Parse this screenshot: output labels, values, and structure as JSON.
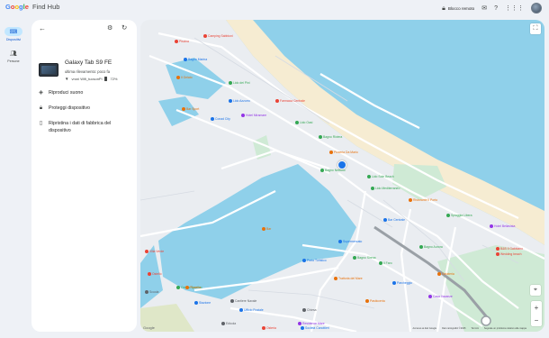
{
  "app": {
    "logo_text": "Google",
    "product": "Find Hub"
  },
  "topbar": {
    "lock_button": "Blocco remoto",
    "icons": [
      "lock-icon",
      "feedback-icon",
      "help-icon",
      "apps-grid-icon",
      "avatar"
    ]
  },
  "rail": {
    "items": [
      {
        "label": "Dispositivi",
        "icon": "devices-icon",
        "active": true
      },
      {
        "label": "Persone",
        "icon": "people-icon",
        "active": false
      }
    ]
  },
  "panel": {
    "device": {
      "name": "Galaxy Tab S9 FE",
      "last_seen": "ultima rilevamento: poco fa",
      "network": "vroni Wifi_tucsonPi",
      "battery": "72%"
    },
    "actions": [
      {
        "label": "Riproduci suono",
        "icon": "sound-icon"
      },
      {
        "label": "Proteggi dispositivo",
        "icon": "lock-icon"
      },
      {
        "label": "Ripristina i dati di fabbrica del dispositivo",
        "icon": "reset-icon"
      }
    ]
  },
  "map": {
    "footer": [
      "Accesso ai dati Google",
      "Dati cartografici ©2025",
      "Termini",
      "Segnala un problema relativo alla mappa"
    ],
    "google_mark": "Google",
    "labels": [
      {
        "text": "Piscina",
        "color": "#ea4335"
      },
      {
        "text": "Camping Sabbioni",
        "color": "#ea4335"
      },
      {
        "text": "Bagno Marina",
        "color": "#1a73e8"
      },
      {
        "text": "Il Gelato",
        "color": "#e8710a"
      },
      {
        "text": "Lido dei Pini",
        "color": "#34a853"
      },
      {
        "text": "Bar Sport",
        "color": "#e8710a"
      },
      {
        "text": "Lido Azzurro",
        "color": "#1a73e8"
      },
      {
        "text": "Farmacia Centrale",
        "color": "#ea4335"
      },
      {
        "text": "Hotel Miramare",
        "color": "#9334e6"
      },
      {
        "text": "Conad City",
        "color": "#1a73e8"
      },
      {
        "text": "Lido Oasi",
        "color": "#34a853"
      },
      {
        "text": "Bagno Riviera",
        "color": "#34a853"
      },
      {
        "text": "Pizzeria Da Mario",
        "color": "#e8710a"
      },
      {
        "text": "Lido Sole Beach",
        "color": "#34a853"
      },
      {
        "text": "Bagno Nettuno",
        "color": "#34a853"
      },
      {
        "text": "Ristorante Il Porto",
        "color": "#e8710a"
      },
      {
        "text": "Lido Mediterraneo",
        "color": "#34a853"
      },
      {
        "text": "Spiaggia Libera",
        "color": "#34a853"
      },
      {
        "text": "Hotel Bellavista",
        "color": "#9334e6"
      },
      {
        "text": "Bar Centrale",
        "color": "#1a73e8"
      },
      {
        "text": "Supermercato",
        "color": "#1a73e8"
      },
      {
        "text": "Il Faro",
        "color": "#34a853"
      },
      {
        "text": "Porto Turistico",
        "color": "#1a73e8"
      },
      {
        "text": "Trattoria del Mare",
        "color": "#e8710a"
      },
      {
        "text": "Parcheggio",
        "color": "#1a73e8"
      },
      {
        "text": "Bagno Aurora",
        "color": "#34a853"
      },
      {
        "text": "Gelateria",
        "color": "#e8710a"
      },
      {
        "text": "Casa Vacanze",
        "color": "#9334e6"
      },
      {
        "text": "Pasticceria",
        "color": "#e8710a"
      },
      {
        "text": "Chiesa",
        "color": "#5f6368"
      },
      {
        "text": "Ufficio Postale",
        "color": "#1a73e8"
      },
      {
        "text": "Stazione",
        "color": "#1a73e8"
      },
      {
        "text": "Scuola",
        "color": "#5f6368"
      },
      {
        "text": "Centro Sportivo",
        "color": "#34a853"
      },
      {
        "text": "B&B Il Gabbiano",
        "color": "#ea4335"
      },
      {
        "text": "Wedding beach",
        "color": "#ea4335"
      },
      {
        "text": "Pizzeria",
        "color": "#e8710a"
      },
      {
        "text": "Ostello",
        "color": "#ea4335"
      },
      {
        "text": "Bar",
        "color": "#e8710a"
      },
      {
        "text": "Villa Verde",
        "color": "#ea4335"
      },
      {
        "text": "Residence Mare",
        "color": "#9334e6"
      },
      {
        "text": "Società Canottieri",
        "color": "#1a73e8"
      },
      {
        "text": "Cantiere Navale",
        "color": "#5f6368"
      },
      {
        "text": "Osteria",
        "color": "#ea4335"
      },
      {
        "text": "Bagno Sirena",
        "color": "#34a853"
      },
      {
        "text": "Edicola",
        "color": "#5f6368"
      }
    ]
  }
}
